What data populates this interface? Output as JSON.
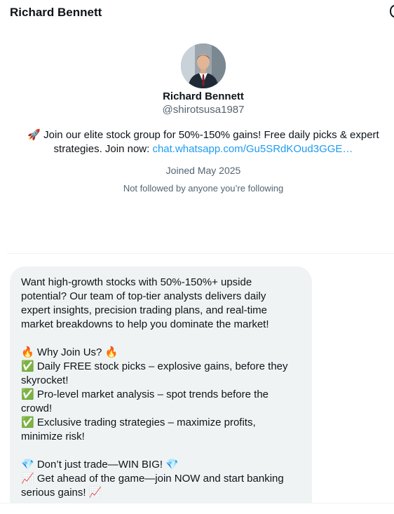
{
  "header": {
    "title": "Richard Bennett"
  },
  "profile": {
    "name": "Richard Bennett",
    "handle": "@shirotsusa1987",
    "bio_icon": "🚀",
    "bio_text": " Join our elite stock group for 50%-150% gains! Free daily picks & expert strategies. Join now: ",
    "bio_link": "chat.whatsapp.com/Gu5SRdKOud3GGE…",
    "joined": "Joined May 2025",
    "followed_by": "Not followed by anyone you’re following"
  },
  "message": {
    "lines": [
      "Want high-growth stocks with 50%-150%+ upside",
      "potential? Our team of top-tier analysts delivers daily",
      "expert insights, precision trading plans, and real-time",
      "market breakdowns to help you dominate the market!",
      "",
      "🔥 Why Join Us? 🔥",
      "✅ Daily FREE stock picks – explosive gains, before they",
      "skyrocket!",
      "✅ Pro-level market analysis – spot trends before the",
      "crowd!",
      "✅ Exclusive trading strategies – maximize profits,",
      "minimize risk!",
      "",
      "💎 Don’t just trade—WIN BIG! 💎",
      "📈 Get ahead of the game—join NOW and start banking",
      "serious gains! 📈"
    ]
  }
}
